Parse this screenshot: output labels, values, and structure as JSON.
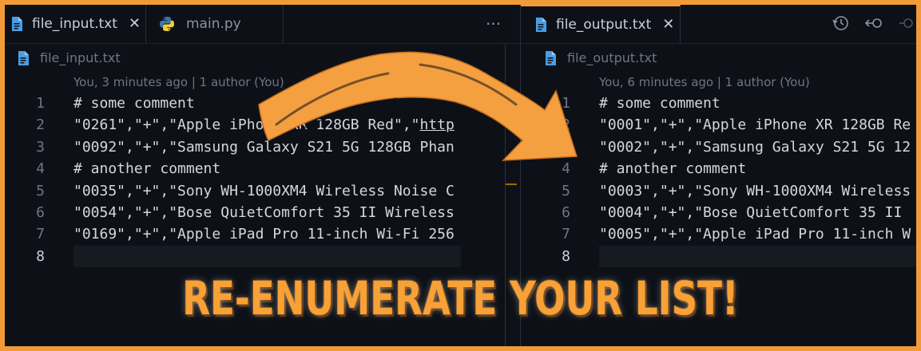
{
  "left": {
    "tabs": [
      {
        "label": "file_input.txt",
        "icon": "file-icon",
        "active": true
      },
      {
        "label": "main.py",
        "icon": "python-icon",
        "active": false
      }
    ],
    "more_label": "···",
    "breadcrumb": "file_input.txt",
    "blame": "You, 3 minutes ago | 1 author (You)",
    "lines": [
      {
        "n": "1",
        "text": "# some comment"
      },
      {
        "n": "2",
        "text": "\"0261\",\"+\",\"Apple iPhone XR 128GB Red\",\"",
        "url": "http"
      },
      {
        "n": "3",
        "text": "\"0092\",\"+\",\"Samsung Galaxy S21 5G 128GB Phan"
      },
      {
        "n": "4",
        "text": "# another comment"
      },
      {
        "n": "5",
        "text": "\"0035\",\"+\",\"Sony WH-1000XM4 Wireless Noise C"
      },
      {
        "n": "6",
        "text": "\"0054\",\"+\",\"Bose QuietComfort 35 II Wireless"
      },
      {
        "n": "7",
        "text": "\"0169\",\"+\",\"Apple iPad Pro 11-inch Wi-Fi 256"
      },
      {
        "n": "8",
        "text": ""
      }
    ]
  },
  "right": {
    "tabs": [
      {
        "label": "file_output.txt",
        "icon": "file-icon",
        "active": true
      }
    ],
    "breadcrumb": "file_output.txt",
    "blame": "You, 6 minutes ago | 1 author (You)",
    "lines": [
      {
        "n": "1",
        "text": "# some comment"
      },
      {
        "n": "2",
        "text": "\"0001\",\"+\",\"Apple iPhone XR 128GB Re"
      },
      {
        "n": "3",
        "text": "\"0002\",\"+\",\"Samsung Galaxy S21 5G 12"
      },
      {
        "n": "4",
        "text": "# another comment"
      },
      {
        "n": "5",
        "text": "\"0003\",\"+\",\"Sony WH-1000XM4 Wireless"
      },
      {
        "n": "6",
        "text": "\"0004\",\"+\",\"Bose QuietComfort 35 II"
      },
      {
        "n": "7",
        "text": "\"0005\",\"+\",\"Apple iPad Pro 11-inch W"
      },
      {
        "n": "8",
        "text": ""
      }
    ]
  },
  "headline": "RE-ENUMERATE YOUR LIST!",
  "colors": {
    "frame": "#f29a38",
    "arrow": "#f5a040",
    "headline": "#f7a136",
    "background": "#0d1117"
  }
}
